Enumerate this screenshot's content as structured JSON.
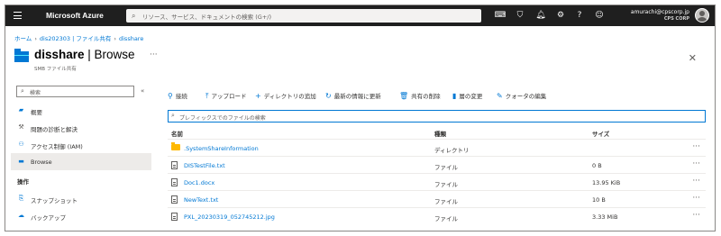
{
  "topbar": {
    "brand": "Microsoft Azure",
    "search_placeholder": "リソース、サービス、ドキュメントの検索 (G+/)",
    "user_email": "amurachi@cpscorp.jp",
    "user_org": "CPS CORP"
  },
  "breadcrumb": [
    "ホーム",
    "dis202303 | ファイル共有",
    "disshare"
  ],
  "header": {
    "title_bold": "disshare",
    "title_rest": " | Browse",
    "subtitle": "SMB ファイル共有"
  },
  "sidebar": {
    "search_placeholder": "検索",
    "items": [
      {
        "label": "概要",
        "icon": "overview-icon"
      },
      {
        "label": "問題の診断と解決",
        "icon": "wrench-icon"
      },
      {
        "label": "アクセス制御 (IAM)",
        "icon": "people-icon"
      },
      {
        "label": "Browse",
        "icon": "folder-icon"
      }
    ],
    "section_header": "操作",
    "ops_items": [
      {
        "label": "スナップショット",
        "icon": "snapshot-icon"
      },
      {
        "label": "バックアップ",
        "icon": "cloud-backup-icon"
      }
    ]
  },
  "toolbar": {
    "connect": "接続",
    "upload": "アップロード",
    "add_directory": "ディレクトリの追加",
    "refresh": "最新の情報に更新",
    "delete_share": "共有の削除",
    "change_tier": "層の変更",
    "edit_quota": "クォータの編集"
  },
  "filter_placeholder": "プレフィックスでのファイルの検索",
  "table": {
    "headers": [
      "名前",
      "種類",
      "サイズ"
    ],
    "rows": [
      {
        "name": ".SystemShareInformation",
        "type": "ディレクトリ",
        "size": "",
        "icon": "folder"
      },
      {
        "name": "DISTestFile.txt",
        "type": "ファイル",
        "size": "0 B",
        "icon": "file"
      },
      {
        "name": "Doc1.docx",
        "type": "ファイル",
        "size": "13.95 KiB",
        "icon": "file"
      },
      {
        "name": "NewText.txt",
        "type": "ファイル",
        "size": "10 B",
        "icon": "file"
      },
      {
        "name": "PXL_20230319_052745212.jpg",
        "type": "ファイル",
        "size": "3.33 MiB",
        "icon": "file"
      }
    ]
  },
  "colors": {
    "accent": "#0078d4",
    "topbar": "#1f1f1f",
    "folder": "#ffb900"
  }
}
